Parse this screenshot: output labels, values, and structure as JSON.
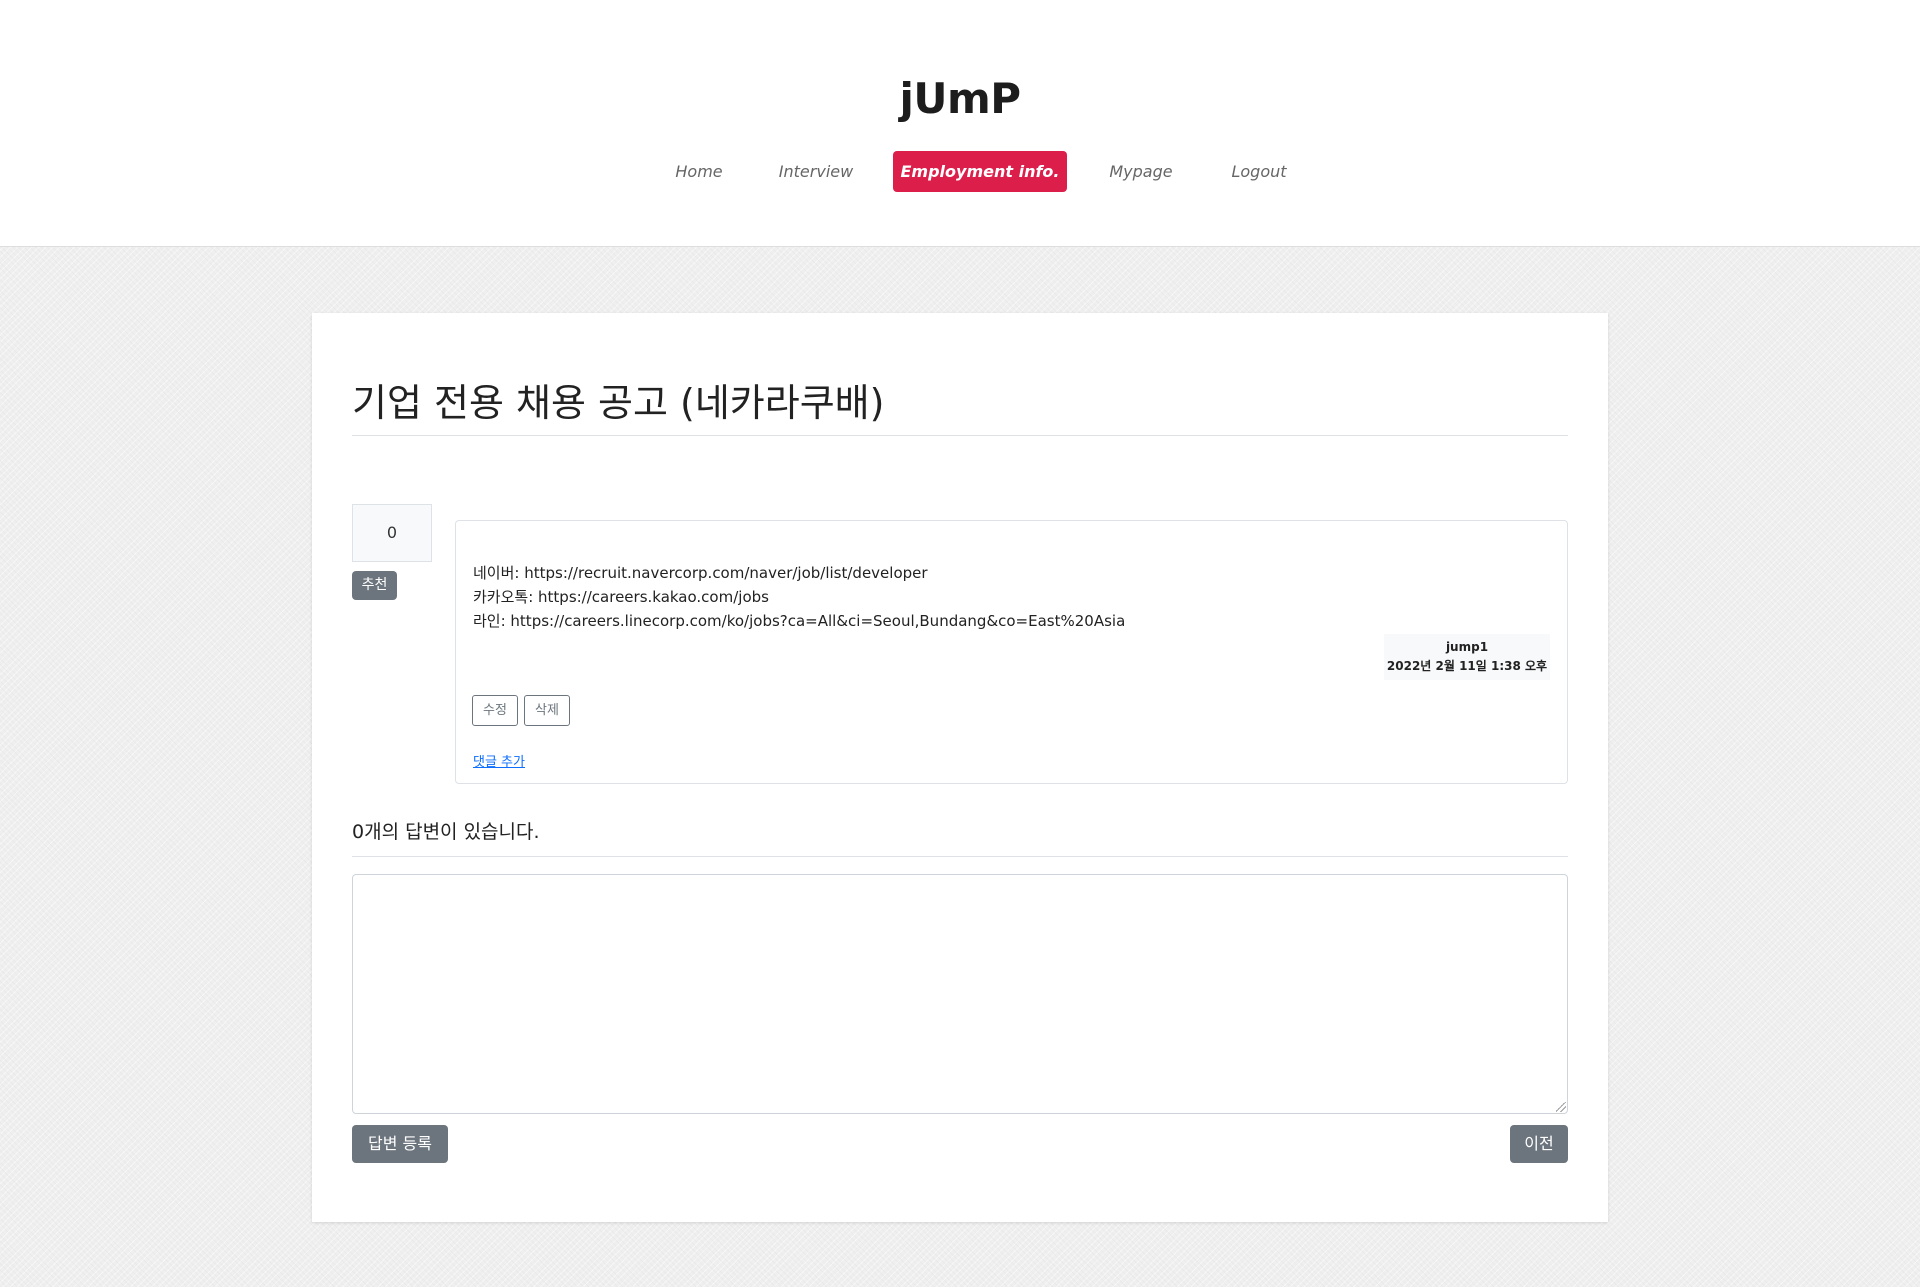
{
  "header": {
    "brand": "jUmP",
    "nav": [
      {
        "label": "Home",
        "active": false
      },
      {
        "label": "Interview",
        "active": false
      },
      {
        "label": "Employment info.",
        "active": true
      },
      {
        "label": "Mypage",
        "active": false
      },
      {
        "label": "Logout",
        "active": false
      }
    ]
  },
  "question": {
    "title": "기업 전용 채용 공고 (네카라쿠배)",
    "vote_count": "0",
    "recommend_label": "추천",
    "content": [
      "네이버: https://recruit.navercorp.com/naver/job/list/developer",
      "카카오톡: https://careers.kakao.com/jobs",
      "라인: https://careers.linecorp.com/ko/jobs?ca=All&ci=Seoul,Bundang&co=East%20Asia"
    ],
    "author": "jump1",
    "date": "2022년 2월 11일 1:38 오후",
    "edit_label": "수정",
    "delete_label": "삭제",
    "add_comment_label": "댓글 추가"
  },
  "answers": {
    "heading": "0개의 답변이 있습니다.",
    "input_value": "",
    "submit_label": "답변 등록",
    "prev_label": "이전"
  },
  "colors": {
    "accent": "#dc1e4a",
    "secondary": "#6c757d",
    "link": "#0d6efd"
  }
}
